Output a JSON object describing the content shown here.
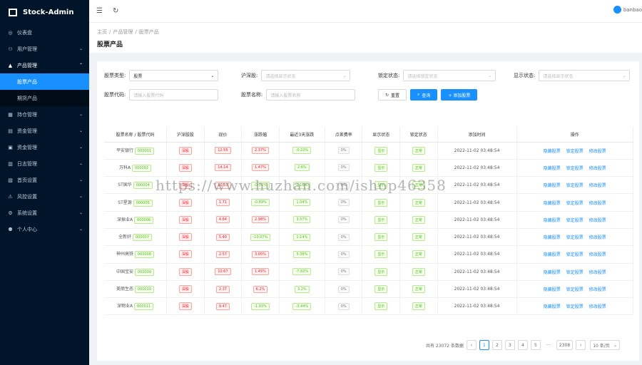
{
  "app": {
    "name": "Stock-Admin",
    "user": "banbao"
  },
  "sidebar": {
    "items": [
      {
        "label": "仪表盘",
        "icon": "dashboard-icon"
      },
      {
        "label": "用户管理",
        "icon": "user-icon"
      },
      {
        "label": "产品管理",
        "icon": "chart-icon"
      },
      {
        "label": "股票产品"
      },
      {
        "label": "期货产品"
      },
      {
        "label": "持仓管理",
        "icon": "position-icon"
      },
      {
        "label": "资金管理",
        "icon": "fund-icon"
      },
      {
        "label": "资金管理",
        "icon": "money-icon"
      },
      {
        "label": "日志管理",
        "icon": "log-icon"
      },
      {
        "label": "首页设置",
        "icon": "home-icon"
      },
      {
        "label": "风控设置",
        "icon": "risk-icon"
      },
      {
        "label": "系统设置",
        "icon": "settings-icon"
      },
      {
        "label": "个人中心",
        "icon": "person-icon"
      }
    ]
  },
  "breadcrumb": [
    "主页",
    "产品管理",
    "股票产品"
  ],
  "page_title": "股票产品",
  "filters": {
    "type_label": "股票类型:",
    "type_value": "股票",
    "market_label": "沪深股:",
    "market_placeholder": "请选择显示状态",
    "lock_label": "锁定状态:",
    "lock_placeholder": "请选择锁定状态",
    "show_label": "显示状态:",
    "show_placeholder": "请选择显示状态",
    "code_label": "股票代码:",
    "code_placeholder": "请输入股票代码",
    "name_label": "股票名称:",
    "name_placeholder": "请输入股票名称",
    "reset": "重置",
    "search": "查询",
    "add": "+ 添加股票"
  },
  "table": {
    "headers": [
      "股票名称 / 股票代码",
      "沪深股股",
      "现价",
      "涨跌幅",
      "最近3天涨跌",
      "点差费率",
      "显示状态",
      "锁定状态",
      "添加时间",
      "操作"
    ],
    "actions": [
      "隐藏股票",
      "锁定股票",
      "修改股票"
    ],
    "rows": [
      [
        "平安银行",
        "000001",
        "深股",
        "12.55",
        "2.37%",
        "-0.22%",
        "0%",
        "显示",
        "正常",
        "2022-11-02 03:48:54"
      ],
      [
        "万科A",
        "000002",
        "深股",
        "14.14",
        "1.47%",
        "2.6%",
        "0%",
        "显示",
        "正常",
        "2022-11-02 03:48:54"
      ],
      [
        "ST国华",
        "000004",
        "深股",
        "10.53",
        "-0.31%",
        "0.16%",
        "0%",
        "显示",
        "正常",
        "2022-11-02 03:48:54"
      ],
      [
        "ST星源",
        "000005",
        "深股",
        "1.71",
        "-0.89%",
        "1.04%",
        "0%",
        "显示",
        "正常",
        "2022-11-02 03:48:54"
      ],
      [
        "深振业A",
        "000006",
        "深股",
        "4.84",
        "2.98%",
        "3.57%",
        "0%",
        "显示",
        "正常",
        "2022-11-02 03:48:54"
      ],
      [
        "全新好",
        "000007",
        "深股",
        "5.40",
        "-10.07%",
        "1.14%",
        "0%",
        "显示",
        "正常",
        "2022-11-02 03:48:54"
      ],
      [
        "神州高铁",
        "000008",
        "深股",
        "2.57",
        "3.05%",
        "5.38%",
        "0%",
        "显示",
        "正常",
        "2022-11-02 03:48:54"
      ],
      [
        "中国宝安",
        "000009",
        "深股",
        "10.67",
        "1.45%",
        "-7.82%",
        "0%",
        "显示",
        "正常",
        "2022-11-02 03:48:54"
      ],
      [
        "美丽生态",
        "000010",
        "深股",
        "2.37",
        "6.2%",
        "3.2%",
        "0%",
        "显示",
        "正常",
        "2022-11-02 03:48:54"
      ],
      [
        "深物业A",
        "000011",
        "深股",
        "9.47",
        "-1.93%",
        "-3.44%",
        "0%",
        "显示",
        "正常",
        "2022-11-02 03:48:54"
      ]
    ]
  },
  "pagination": {
    "total": "共有 23072 条数据",
    "pages": [
      "1",
      "2",
      "3",
      "4",
      "5",
      "···",
      "2308"
    ],
    "size": "10 条/页"
  },
  "watermark": "https://www.huzhan.com/ishop46358"
}
